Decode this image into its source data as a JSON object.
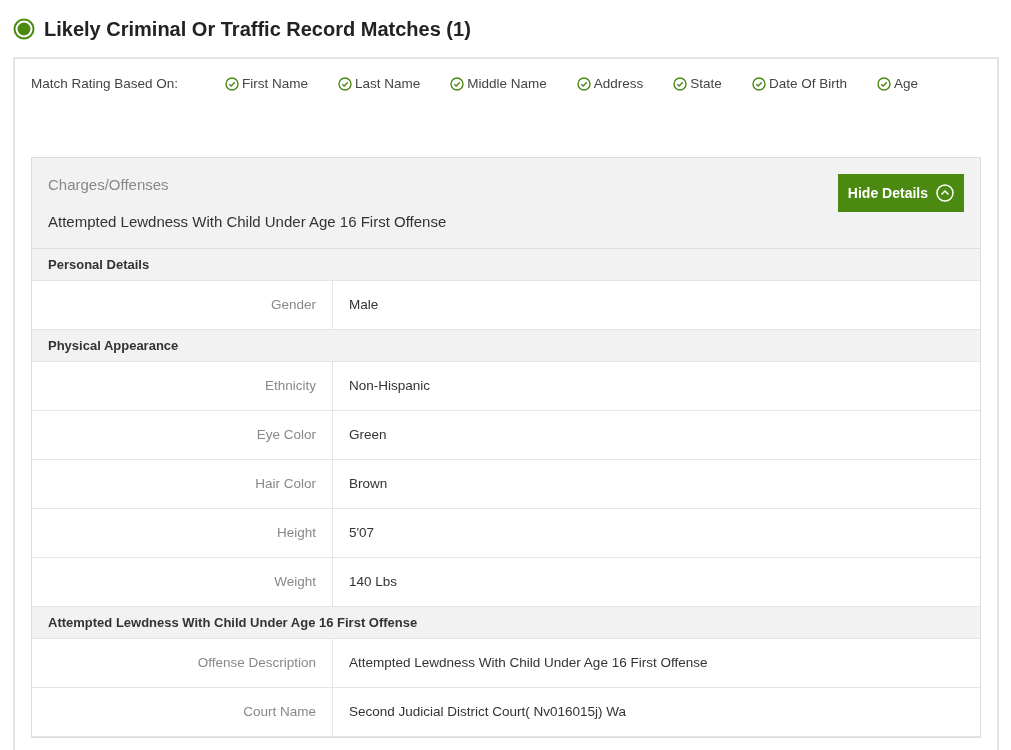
{
  "heading": {
    "title": "Likely Criminal Or Traffic Record Matches (1)"
  },
  "match_rating": {
    "label": "Match Rating Based On:",
    "criteria": [
      {
        "label": "First Name",
        "matched": true
      },
      {
        "label": "Last Name",
        "matched": true
      },
      {
        "label": "Middle Name",
        "matched": true
      },
      {
        "label": "Address",
        "matched": true
      },
      {
        "label": "State",
        "matched": true
      },
      {
        "label": "Date Of Birth",
        "matched": true
      },
      {
        "label": "Age",
        "matched": true
      }
    ]
  },
  "record": {
    "charges_label": "Charges/Offenses",
    "charge": "Attempted Lewdness With Child Under Age 16 First Offense",
    "toggle_button": {
      "label": "Hide Details",
      "expanded": true
    },
    "sections": [
      {
        "title": "Personal Details",
        "rows": [
          {
            "label": "Gender",
            "value": "Male"
          }
        ]
      },
      {
        "title": "Physical Appearance",
        "rows": [
          {
            "label": "Ethnicity",
            "value": "Non-Hispanic"
          },
          {
            "label": "Eye Color",
            "value": "Green"
          },
          {
            "label": "Hair Color",
            "value": "Brown"
          },
          {
            "label": "Height",
            "value": "5'07"
          },
          {
            "label": "Weight",
            "value": "140 Lbs"
          }
        ]
      },
      {
        "title": "Attempted Lewdness With Child Under Age 16 First Offense",
        "rows": [
          {
            "label": "Offense Description",
            "value": "Attempted Lewdness With Child Under Age 16 First Offense"
          },
          {
            "label": "Court Name",
            "value": "Second Judicial District Court( Nv016015j) Wa"
          }
        ]
      }
    ]
  }
}
